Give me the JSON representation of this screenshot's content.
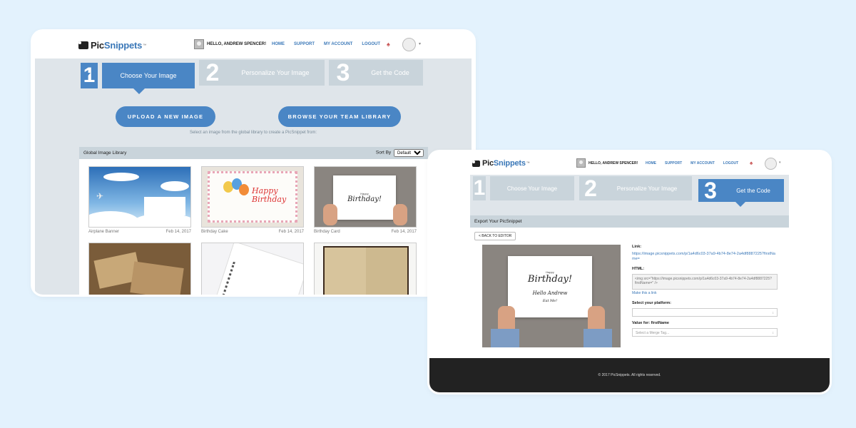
{
  "app": {
    "logo_pic": "Pic",
    "logo_snip": "Snippets",
    "logo_tm": "™"
  },
  "nav": {
    "greeting": "HELLO, ANDREW SPENCER!",
    "links": [
      "HOME",
      "SUPPORT",
      "MY ACCOUNT",
      "LOGOUT"
    ],
    "caret": "▾"
  },
  "steps": [
    {
      "num": "1",
      "label": "Choose Your Image"
    },
    {
      "num": "2",
      "label": "Personalize Your Image"
    },
    {
      "num": "3",
      "label": "Get the Code"
    }
  ],
  "choose": {
    "upload_button": "UPLOAD A NEW IMAGE",
    "browse_button": "BROWSE YOUR TEAM LIBRARY",
    "hint": "Select an image from the global library to create a PicSnippet from:",
    "library_title": "Global Image Library",
    "sort_label": "Sort By",
    "sort_value": "Default",
    "images": [
      {
        "name": "Airplane Banner",
        "date": "Feb 14, 2017"
      },
      {
        "name": "Birthday Cake",
        "date": "Feb 14, 2017"
      },
      {
        "name": "Birthday Card",
        "date": "Feb 14, 2017"
      },
      {
        "name": "",
        "date": ""
      },
      {
        "name": "",
        "date": ""
      },
      {
        "name": "",
        "date": ""
      }
    ],
    "card_text": "Birthday!",
    "card_small": "Happy"
  },
  "export": {
    "title": "Export Your PicSnippet",
    "back_button": "< BACK TO EDITOR",
    "link_label": "Link:",
    "link_url": "https://image.picsnippets.com/p/1a4d6c03-37a9-4b74-8e74-2a4df8887225?firstName=",
    "html_label": "HTML:",
    "html_code": "<img src=\"https://image.picsnippets.com/p/1a4d6c03-37a9-4b74-8e74-2a4df8887225?firstName=\" />",
    "make_link": "Make this a link",
    "platform_label": "Select your platform:",
    "value_label": "Value for: firstName",
    "merge_placeholder": "Select a Merge Tag...",
    "preview_title": "Birthday!",
    "preview_small": "Happy",
    "preview_name": "Hello Andrew",
    "preview_sign": "Eat Me!",
    "footer": "© 2017 PicSnippets. All rights reserved."
  }
}
